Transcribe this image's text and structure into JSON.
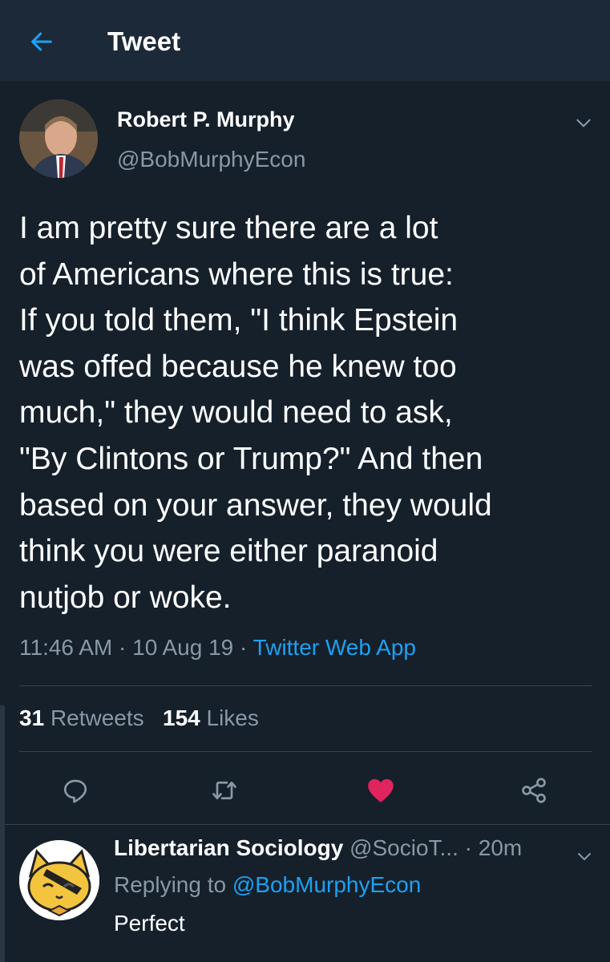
{
  "header": {
    "title": "Tweet",
    "back_icon": "arrow-left-icon",
    "accent": "#1da1f2"
  },
  "tweet": {
    "author_name": "Robert P. Murphy",
    "author_handle": "@BobMurphyEcon",
    "text": "I am pretty sure there are a lot\nof Americans where this is true:\nIf you told them, \"I think Epstein\nwas offed because he knew too\nmuch,\" they would need to ask,\n\"By Clintons or Trump?\" And then\nbased on your answer, they would\nthink you were either paranoid\nnutjob or woke.",
    "time": "11:46 AM",
    "date": "10 Aug 19",
    "source": "Twitter Web App",
    "retweets_count": "31",
    "retweets_label": "Retweets",
    "likes_count": "154",
    "likes_label": "Likes"
  },
  "actions": [
    {
      "icon": "reply-icon"
    },
    {
      "icon": "retweet-icon"
    },
    {
      "icon": "heart-icon",
      "color": "#e0245e",
      "active": true
    },
    {
      "icon": "share-icon"
    }
  ],
  "reply": {
    "name": "Libertarian Sociology",
    "handle": "@SocioT...",
    "time": "20m",
    "replying_prefix": "Replying to",
    "replying_to": "@BobMurphyEcon",
    "text": "Perfect"
  },
  "colors": {
    "background": "#15202b",
    "header": "#1c2938",
    "secondary_text": "#8899a6",
    "divider": "#38444d"
  }
}
